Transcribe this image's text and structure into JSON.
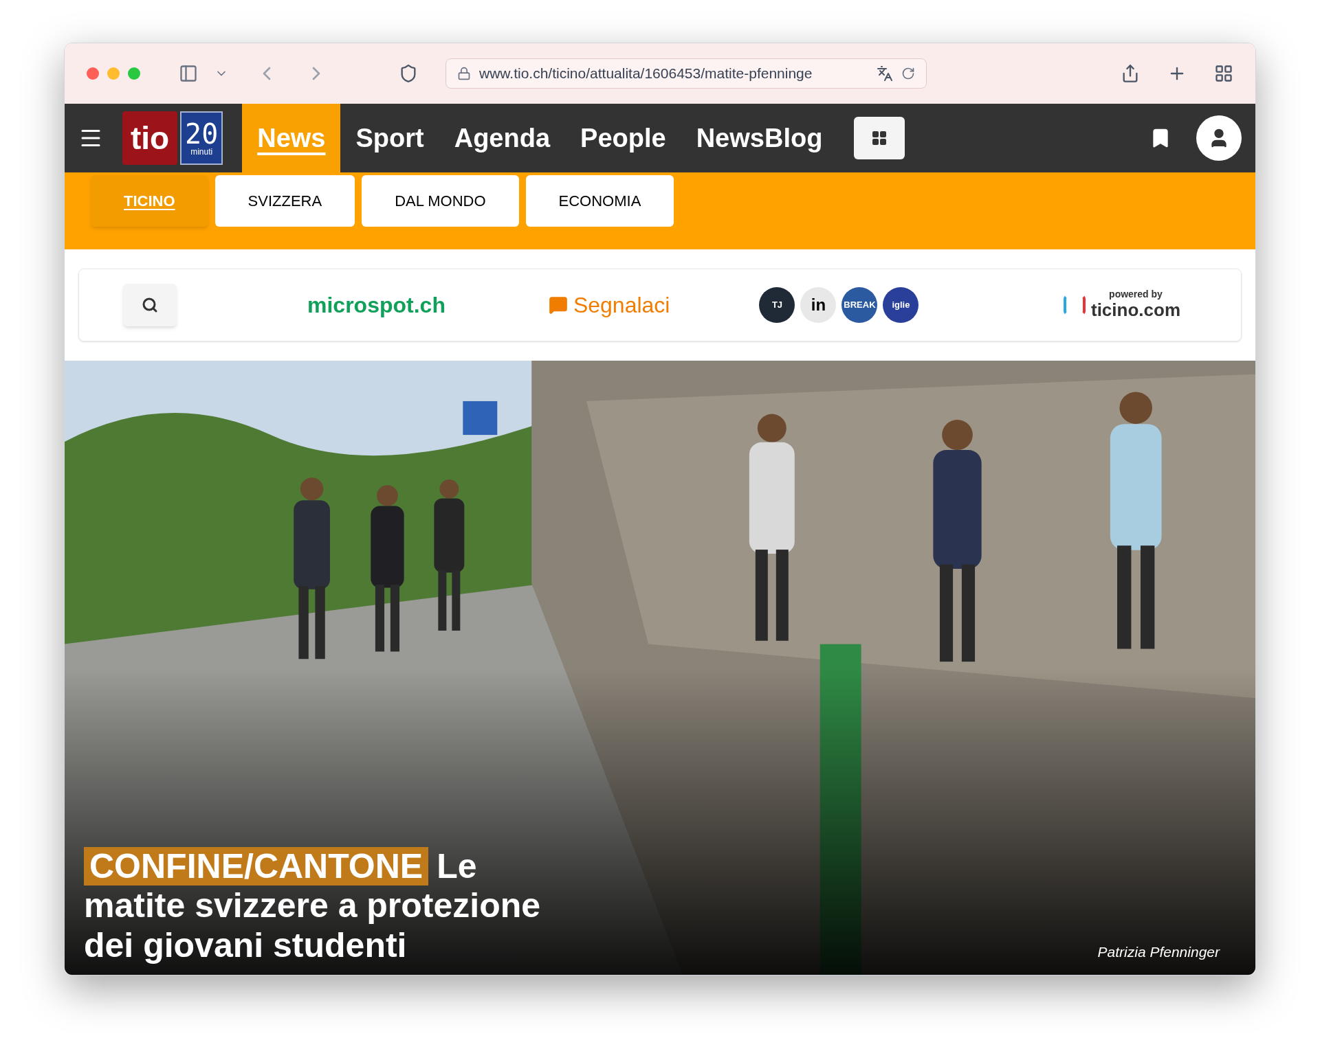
{
  "browser": {
    "url": "www.tio.ch/ticino/attualita/1606453/matite-pfenninge"
  },
  "logo": {
    "text": "tio",
    "badge_number": "20",
    "badge_caption": "minuti"
  },
  "nav": [
    {
      "label": "News",
      "selected": true
    },
    {
      "label": "Sport",
      "selected": false
    },
    {
      "label": "Agenda",
      "selected": false
    },
    {
      "label": "People",
      "selected": false
    },
    {
      "label": "NewsBlog",
      "selected": false
    }
  ],
  "subnav": [
    {
      "label": "TICINO",
      "selected": true
    },
    {
      "label": "SVIZZERA",
      "selected": false
    },
    {
      "label": "DAL MONDO",
      "selected": false
    },
    {
      "label": "ECONOMIA",
      "selected": false
    }
  ],
  "partners": {
    "microspot": "microspot.ch",
    "report": "Segnalaci",
    "badges": [
      {
        "text": "TJ",
        "color": "#1f2a36"
      },
      {
        "text": "in",
        "color": "#e8e8e8"
      },
      {
        "text": "BREAK",
        "color": "#2c5aa0"
      },
      {
        "text": "iglie",
        "color": "#2a3f9a"
      }
    ],
    "powered_by": "powered by",
    "ticino": "ticino.com"
  },
  "article": {
    "kicker": "CONFINE/CANTONE",
    "title": "Le matite svizzere a protezione dei giovani studenti",
    "credit": "Patrizia Pfenninger"
  }
}
